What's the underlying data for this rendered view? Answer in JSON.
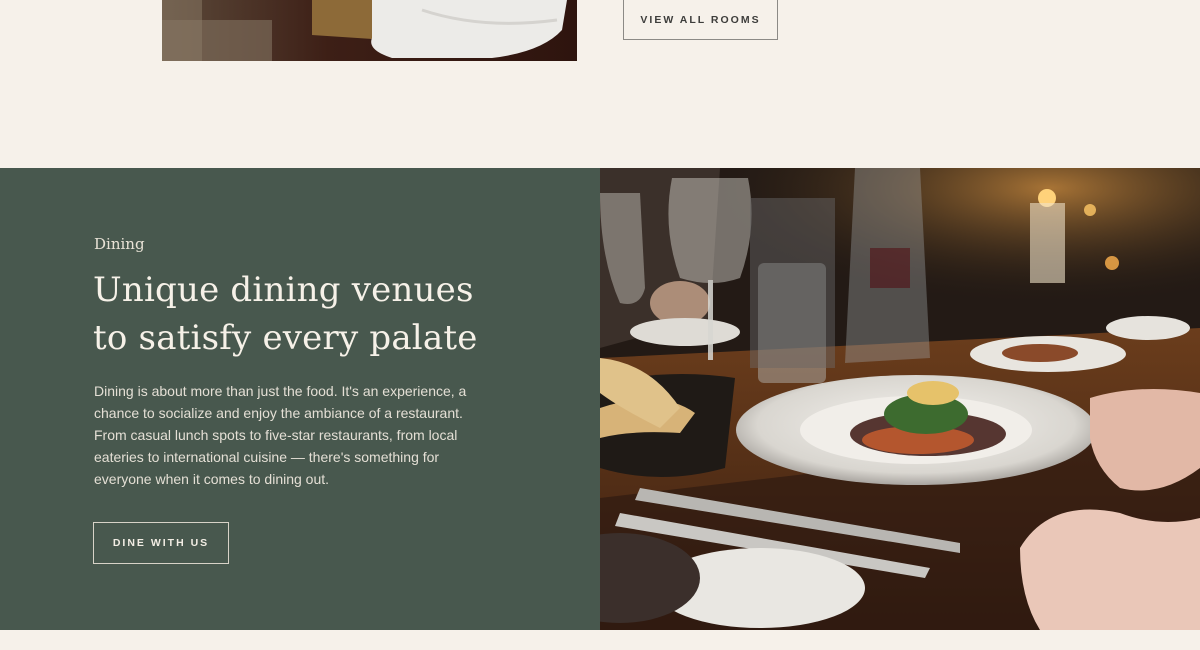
{
  "rooms": {
    "view_all_label": "VIEW ALL ROOMS"
  },
  "dining": {
    "eyebrow": "Dining",
    "heading_line1": "Unique dining venues",
    "heading_line2": "to satisfy every palate",
    "body": "Dining is about more than just the food. It's an experience, a chance to socialize and enjoy the ambiance of a restaurant. From casual lunch spots to five-star restaurants, from local eateries to international cuisine — there's something for everyone when it comes to dining out.",
    "cta_label": "DINE WITH US"
  },
  "colors": {
    "page_background": "#f6f1ea",
    "dining_panel": "#48584e",
    "light_text": "#f2ede4"
  }
}
